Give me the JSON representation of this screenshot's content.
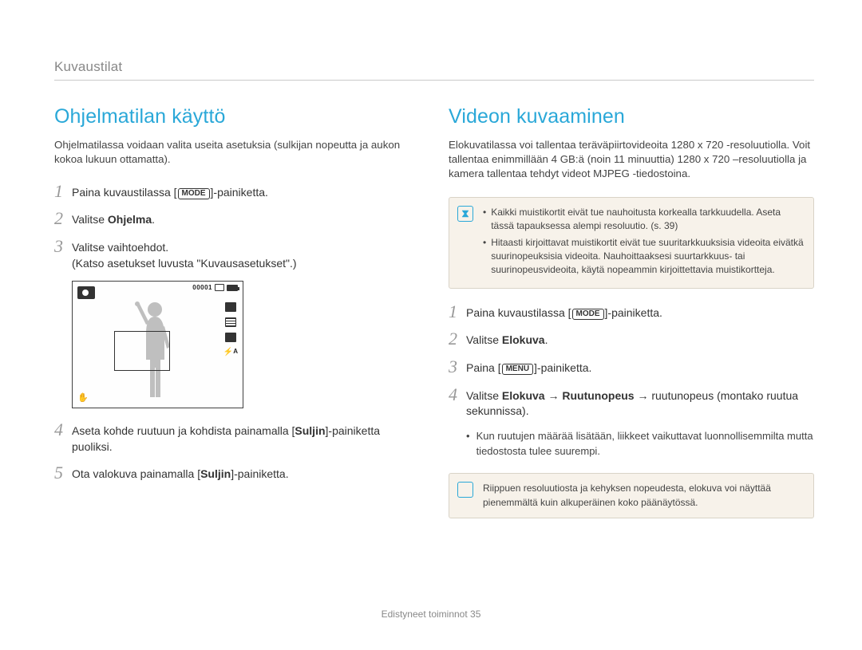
{
  "breadcrumb": "Kuvaustilat",
  "footer": {
    "text": "Edistyneet toiminnot  35"
  },
  "left": {
    "heading": "Ohjelmatilan käyttö",
    "intro": "Ohjelmatilassa voidaan valita useita asetuksia (sulkijan nopeutta ja aukon kokoa lukuun ottamatta).",
    "step1_pre": "Paina kuvaustilassa [",
    "step1_mode": "MODE",
    "step1_post": "]-painiketta.",
    "step2_pre": "Valitse ",
    "step2_bold": "Ohjelma",
    "step2_post": ".",
    "step3_a": "Valitse vaihtoehdot.",
    "step3_b": "(Katso asetukset luvusta \"Kuvausasetukset\".)",
    "screen": {
      "counter": "00001"
    },
    "step4_pre": "Aseta kohde ruutuun ja kohdista painamalla [",
    "step4_bold": "Suljin",
    "step4_post": "]-painiketta puoliksi.",
    "step5_pre": "Ota valokuva painamalla [",
    "step5_bold": "Suljin",
    "step5_post": "]-painiketta."
  },
  "right": {
    "heading": "Videon kuvaaminen",
    "intro": "Elokuvatilassa voi tallentaa teräväpiirtovideoita 1280 x 720 -resoluutiolla. Voit tallentaa enimmillään 4 GB:ä (noin 11 minuuttia) 1280 x 720 –resoluutiolla ja kamera tallentaa tehdyt videot MJPEG -tiedostoina.",
    "note1_item1": "Kaikki muistikortit eivät tue nauhoitusta korkealla tarkkuudella. Aseta tässä tapauksessa alempi resoluutio. (s. 39)",
    "note1_item2": "Hitaasti kirjoittavat muistikortit eivät tue suuritarkkuuksisia videoita eivätkä suurinopeuksisia videoita. Nauhoittaaksesi suurtarkkuus- tai suurinopeusvideoita, käytä nopeammin kirjoittettavia muistikortteja.",
    "step1_pre": "Paina kuvaustilassa [",
    "step1_mode": "MODE",
    "step1_post": "]-painiketta.",
    "step2_pre": "Valitse ",
    "step2_bold": "Elokuva",
    "step2_post": ".",
    "step3_pre": "Paina [",
    "step3_menu": "MENU",
    "step3_post": "]-painiketta.",
    "step4_pre": "Valitse ",
    "step4_b1": "Elokuva",
    "step4_arrow1": " → ",
    "step4_b2": "Ruutunopeus",
    "step4_arrow2": " → ",
    "step4_tail": "ruutunopeus (montako ruutua sekunnissa).",
    "step4_bullet": "Kun ruutujen määrää lisätään, liikkeet vaikuttavat luonnollisemmilta mutta tiedostosta tulee suurempi.",
    "note2": "Riippuen resoluutiosta ja kehyksen nopeudesta, elokuva voi näyttää pienemmältä kuin alkuperäinen koko päänäytössä."
  }
}
